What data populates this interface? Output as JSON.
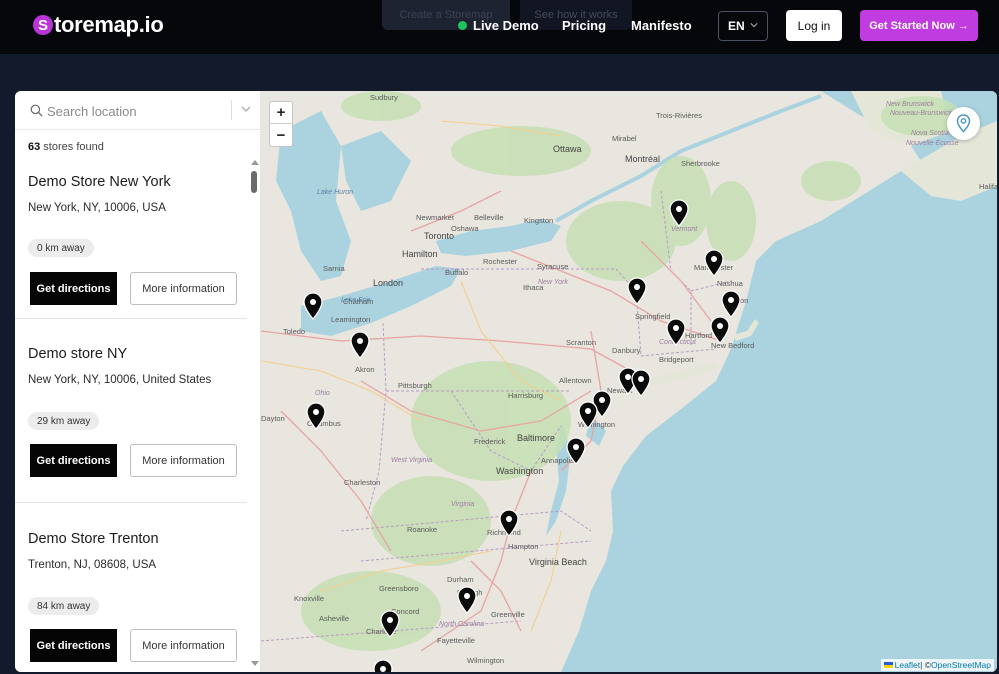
{
  "header": {
    "logo_letter": "S",
    "logo_text": "toremap.io",
    "ghost_a": "Create a Storemap",
    "ghost_b": "See how it works",
    "nav": [
      "Live Demo",
      "Pricing",
      "Manifesto"
    ],
    "lang": "EN",
    "login": "Log in",
    "cta": "Get Started Now →",
    "colors": {
      "accent": "#c03be0",
      "live": "#1fc45a",
      "bg": "#05070b"
    }
  },
  "sidebar": {
    "search_placeholder": "Search location",
    "count": "63",
    "count_suffix": " stores found",
    "stores": [
      {
        "name": "Demo Store New York",
        "address": "New York, NY, 10006, USA",
        "distance": "0 km away",
        "directions": "Get directions",
        "info": "More information"
      },
      {
        "name": "Demo store NY",
        "address": "New York, NY, 10006, United States",
        "distance": "29 km away",
        "directions": "Get directions",
        "info": "More information"
      },
      {
        "name": "Demo Store Trenton",
        "address": "Trenton, NJ, 08608, USA",
        "distance": "84 km away",
        "directions": "Get directions",
        "info": "More information"
      }
    ]
  },
  "map": {
    "zoom_in": "+",
    "zoom_out": "−",
    "attribution_leaflet": "Leaflet",
    "attribution_sep": " | © ",
    "attribution_osm": "OpenStreetMap",
    "cities": [
      "Sudbury",
      "Ottawa",
      "Montréal",
      "Trois-Rivières",
      "Sherbrooke",
      "Mirabel",
      "Toronto",
      "Hamilton",
      "Kingston",
      "Belleville",
      "Newmarket",
      "Oshawa",
      "Rochester",
      "Buffalo",
      "Syracuse",
      "London",
      "Chatham",
      "Sarnia",
      "Leamington",
      "Toledo",
      "Akron",
      "Pittsburgh",
      "Columbus",
      "Dayton",
      "Harrisburg",
      "Allentown",
      "Scranton",
      "Danbury",
      "Springfield",
      "Hartford",
      "Bridgeport",
      "New Bedford",
      "Boston",
      "Nashua",
      "Manchester",
      "Baltimore",
      "Frederick",
      "Washington",
      "Annapolis",
      "Wilmington",
      "Charleston",
      "Roanoke",
      "Richmond",
      "Hampton",
      "Virginia Beach",
      "Greensboro",
      "Raleigh",
      "Greenville",
      "Concord",
      "Charlotte",
      "Knoxville",
      "Asheville",
      "Wilmington",
      "Fayetteville",
      "Durham",
      "Ithaca",
      "Newark"
    ],
    "regions": [
      "Ohio",
      "West Virginia",
      "Virginia",
      "North Carolina",
      "New York",
      "Vermont",
      "Connecticut",
      "New Brunswick",
      "Nouveau-Brunswick",
      "Nova Scotia",
      "Nouvelle-Écosse",
      "Halifax",
      "Lake Huron",
      "Lake Erie"
    ]
  }
}
